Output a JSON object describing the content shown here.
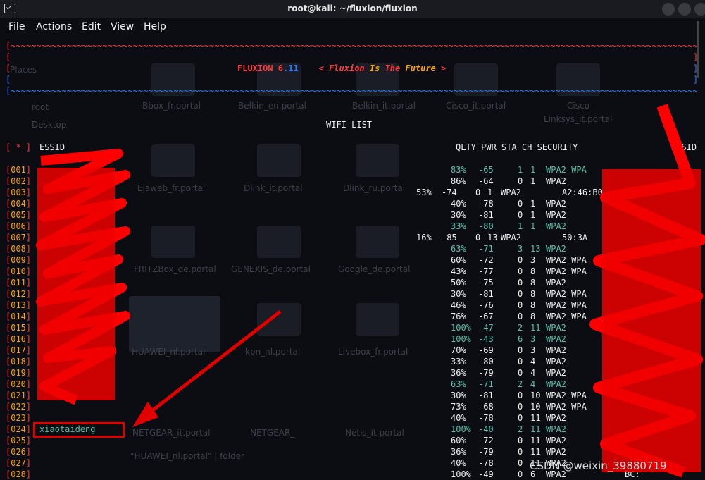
{
  "window": {
    "title": "root@kali: ~/fluxion/fluxion"
  },
  "menu": [
    "File",
    "Actions",
    "Edit",
    "View",
    "Help"
  ],
  "banner": {
    "name": "FLUXION 6",
    "version": ".11",
    "slogan_open": "< ",
    "w1": "Fluxion",
    "w2": "Is",
    "w3": "The",
    "w4": "Future",
    "slogan_close": " >"
  },
  "wifi_list_title": "WIFI LIST",
  "header": {
    "star": "[ * ]",
    "essid": "ESSID",
    "cols": "QLTY PWR STA CH SECURITY",
    "bssid": "BSSID"
  },
  "rows": [
    {
      "n": "001",
      "ssid": "",
      "q": "83%",
      "p": "-65",
      "s": "1",
      "c": "1",
      "sec": "WPA2 WPA",
      "b": "",
      "hl": true
    },
    {
      "n": "002",
      "ssid": "",
      "q": "86%",
      "p": "-64",
      "s": "0",
      "c": "1",
      "sec": "WPA2",
      "b": "",
      "hl": false
    },
    {
      "n": "003",
      "ssid": "",
      "q": "53%",
      "p": "-74",
      "s": "0",
      "c": "1",
      "sec": "WPA2",
      "b": "A2:46:B0",
      "hl": false,
      "shift": true
    },
    {
      "n": "004",
      "ssid": "",
      "q": "40%",
      "p": "-78",
      "s": "0",
      "c": "1",
      "sec": "WPA2",
      "b": "",
      "hl": false
    },
    {
      "n": "005",
      "ssid": "",
      "q": "30%",
      "p": "-81",
      "s": "0",
      "c": "1",
      "sec": "WPA2",
      "b": "",
      "hl": false
    },
    {
      "n": "006",
      "ssid": "",
      "q": "33%",
      "p": "-80",
      "s": "1",
      "c": "1",
      "sec": "WPA2",
      "b": "",
      "hl": true
    },
    {
      "n": "007",
      "ssid": "",
      "q": "16%",
      "p": "-85",
      "s": "0",
      "c": "13",
      "sec": "WPA2",
      "b": "50:3A",
      "hl": false,
      "shift": true
    },
    {
      "n": "008",
      "ssid": "",
      "q": "63%",
      "p": "-71",
      "s": "3",
      "c": "13",
      "sec": "WPA2",
      "b": "",
      "hl": true
    },
    {
      "n": "009",
      "ssid": "",
      "q": "60%",
      "p": "-72",
      "s": "0",
      "c": "3",
      "sec": "WPA2 WPA",
      "b": "",
      "hl": false
    },
    {
      "n": "010",
      "ssid": "",
      "q": "43%",
      "p": "-77",
      "s": "0",
      "c": "8",
      "sec": "WPA2 WPA",
      "b": "",
      "hl": false
    },
    {
      "n": "011",
      "ssid": "",
      "q": "50%",
      "p": "-75",
      "s": "0",
      "c": "8",
      "sec": "WPA2",
      "b": "",
      "hl": false
    },
    {
      "n": "012",
      "ssid": "",
      "q": "30%",
      "p": "-81",
      "s": "0",
      "c": "8",
      "sec": "WPA2 WPA",
      "b": "",
      "hl": false
    },
    {
      "n": "013",
      "ssid": "",
      "q": "46%",
      "p": "-76",
      "s": "0",
      "c": "8",
      "sec": "WPA2 WPA",
      "b": "",
      "hl": false
    },
    {
      "n": "014",
      "ssid": "",
      "q": "76%",
      "p": "-67",
      "s": "0",
      "c": "8",
      "sec": "WPA2 WPA",
      "b": "",
      "hl": false
    },
    {
      "n": "015",
      "ssid": "",
      "q": "100%",
      "p": "-47",
      "s": "2",
      "c": "11",
      "sec": "WPA2",
      "b": "",
      "hl": true
    },
    {
      "n": "016",
      "ssid": "",
      "q": "100%",
      "p": "-43",
      "s": "6",
      "c": "3",
      "sec": "WPA2",
      "b": "",
      "hl": true
    },
    {
      "n": "017",
      "ssid": "",
      "q": "70%",
      "p": "-69",
      "s": "0",
      "c": "3",
      "sec": "WPA2",
      "b": "",
      "hl": false
    },
    {
      "n": "018",
      "ssid": "",
      "q": "33%",
      "p": "-80",
      "s": "0",
      "c": "4",
      "sec": "WPA2",
      "b": "",
      "hl": false
    },
    {
      "n": "019",
      "ssid": "",
      "q": "36%",
      "p": "-79",
      "s": "0",
      "c": "4",
      "sec": "WPA2",
      "b": "",
      "hl": false
    },
    {
      "n": "020",
      "ssid": "",
      "q": "63%",
      "p": "-71",
      "s": "2",
      "c": "4",
      "sec": "WPA2",
      "b": "",
      "hl": true
    },
    {
      "n": "021",
      "ssid": "",
      "q": "30%",
      "p": "-81",
      "s": "0",
      "c": "10",
      "sec": "WPA2 WPA",
      "b": "",
      "hl": false
    },
    {
      "n": "022",
      "ssid": "",
      "q": "73%",
      "p": "-68",
      "s": "0",
      "c": "10",
      "sec": "WPA2 WPA",
      "b": "",
      "hl": false
    },
    {
      "n": "023",
      "ssid": "",
      "q": "40%",
      "p": "-78",
      "s": "0",
      "c": "11",
      "sec": "WPA2",
      "b": "",
      "hl": false
    },
    {
      "n": "024",
      "ssid": "xiaotaideng",
      "q": "100%",
      "p": "-40",
      "s": "2",
      "c": "11",
      "sec": "WPA2",
      "b": "",
      "hl": true
    },
    {
      "n": "025",
      "ssid": "",
      "q": "60%",
      "p": "-72",
      "s": "0",
      "c": "11",
      "sec": "WPA2",
      "b": "",
      "hl": false
    },
    {
      "n": "026",
      "ssid": "",
      "q": "36%",
      "p": "-79",
      "s": "0",
      "c": "11",
      "sec": "WPA2",
      "b": "",
      "hl": false
    },
    {
      "n": "027",
      "ssid": "",
      "q": "40%",
      "p": "-78",
      "s": "0",
      "c": "11",
      "sec": "WPA2",
      "b": "",
      "hl": false
    },
    {
      "n": "028",
      "ssid": "",
      "q": "100%",
      "p": "-49",
      "s": "0",
      "c": "6",
      "sec": "WPA2",
      "b": "BC:",
      "hl": false
    }
  ],
  "ghost": [
    "Bbox_fr.portal",
    "Belkin_en.portal",
    "Belkin_it.portal",
    "Cisco_it.portal",
    "Cisco-",
    "Linksys_it.portal",
    "Ejaweb_fr.portal",
    "Dlink_it.portal",
    "Dlink_ru.portal",
    "FRITZBox_de.portal",
    "GENEXIS_de.portal",
    "Google_de.portal",
    "HUAWEI_nl.portal",
    "kpn_nl.portal",
    "Livebox_fr.portal",
    "NETGEAR_it.portal",
    "NETGEAR_",
    "Netis_it.portal",
    "Places",
    "root",
    "Desktop",
    "\"HUAWEI_nl.portal\" | folder"
  ],
  "watermark": "CSDN @weixin_39880719",
  "colors": {
    "background": "#0b0d13",
    "accent_red": "#ff3b3b",
    "accent_blue": "#2b7fff",
    "highlight": "#55c2a6",
    "index": "#ffa500"
  }
}
